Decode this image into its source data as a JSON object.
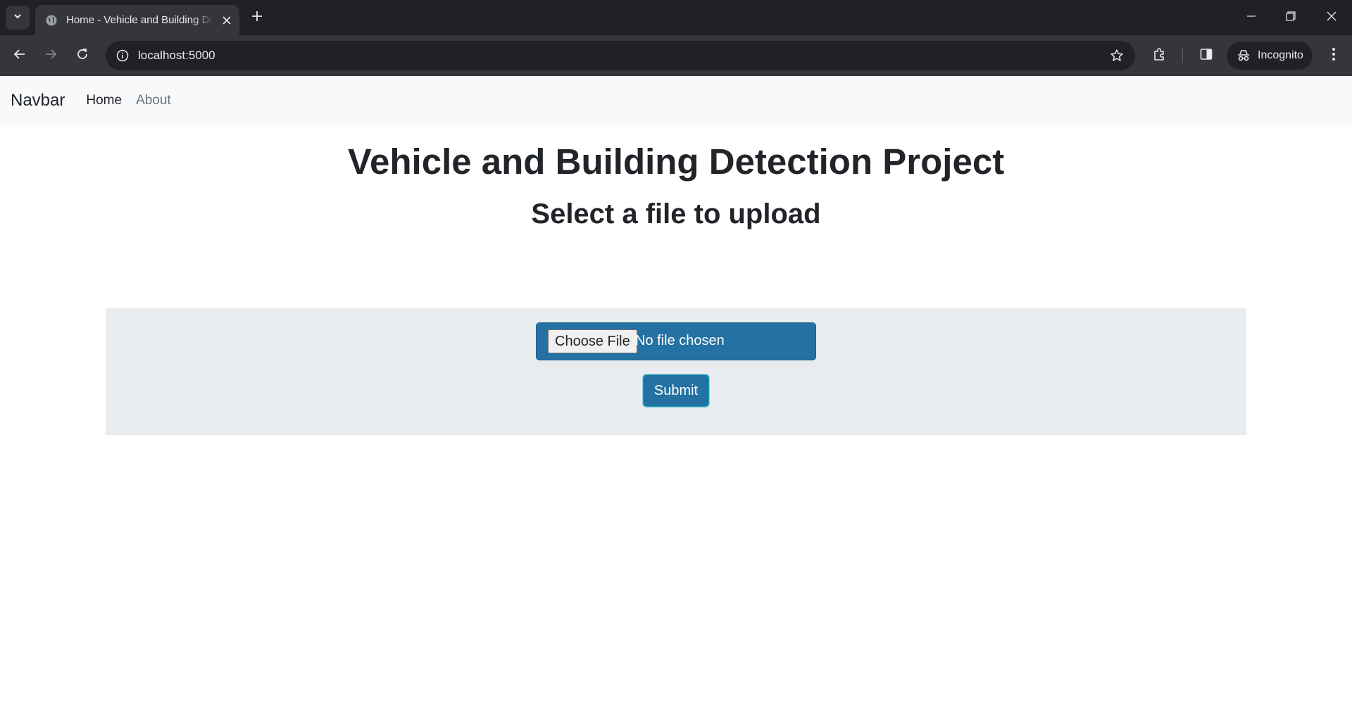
{
  "browser": {
    "tab_title": "Home - Vehicle and Building Detection Project",
    "url": "localhost:5000",
    "incognito_label": "Incognito"
  },
  "navbar": {
    "brand": "Navbar",
    "links": [
      {
        "label": "Home",
        "active": true
      },
      {
        "label": "About",
        "active": false
      }
    ]
  },
  "main": {
    "title": "Vehicle and Building Detection Project",
    "subtitle": "Select a file to upload",
    "file_input": {
      "button_label": "Choose File",
      "status": "No file chosen"
    },
    "submit_label": "Submit"
  },
  "colors": {
    "accent": "#2471a3",
    "navbar_bg": "#f8f9fa",
    "panel_bg": "#e9ecef",
    "chrome_dark": "#202124"
  },
  "icons": [
    "tab-search-icon",
    "globe-icon",
    "close-icon",
    "plus-icon",
    "minimize-icon",
    "restore-icon",
    "back-icon",
    "forward-icon",
    "reload-icon",
    "info-icon",
    "star-icon",
    "extensions-icon",
    "side-panel-icon",
    "incognito-icon",
    "menu-icon"
  ]
}
